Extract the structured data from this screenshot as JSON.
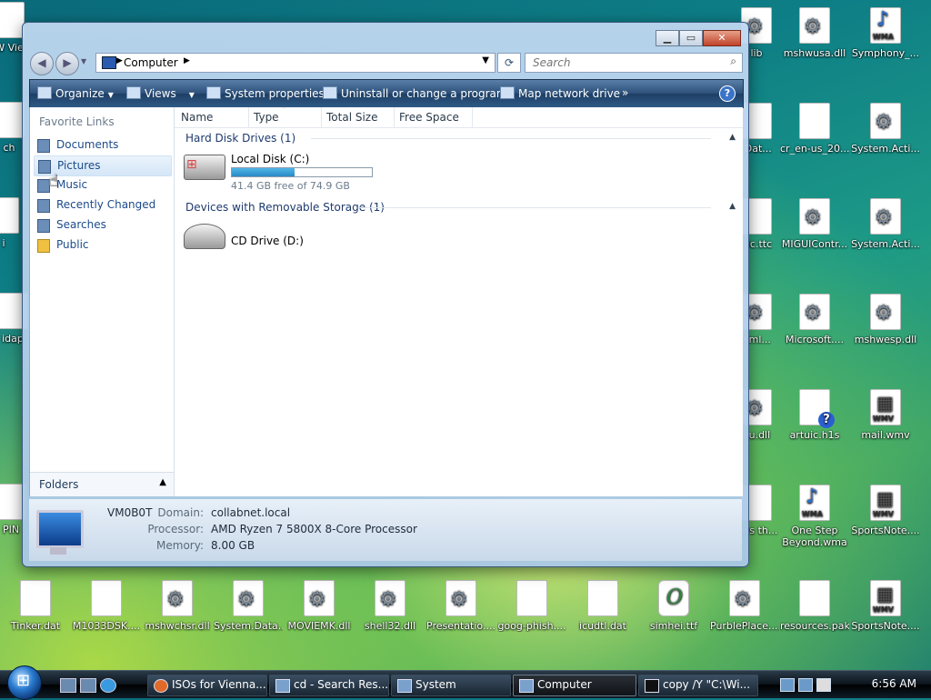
{
  "desktop": {
    "icons_right": [
      {
        "label": "mshwusa.dll",
        "type": "gear"
      },
      {
        "label": "Symphony_...",
        "type": "wma"
      },
      {
        "label": "cr_en-us_20...",
        "type": "doc"
      },
      {
        "label": "System.Acti...",
        "type": "gear"
      },
      {
        "label": "MIGUIContr...",
        "type": "gear"
      },
      {
        "label": "System.Acti...",
        "type": "gear"
      },
      {
        "label": "Microsoft....",
        "type": "gear"
      },
      {
        "label": "mshwesp.dll",
        "type": "gear"
      },
      {
        "label": "artuic.h1s",
        "type": "help"
      },
      {
        "label": "mail.wmv",
        "type": "wmv"
      },
      {
        "label": "One Step Beyond.wma",
        "type": "wma"
      },
      {
        "label": "SportsNote....",
        "type": "wmv"
      },
      {
        "label": "resources.pak",
        "type": "doc"
      },
      {
        "label": "SportsNote....",
        "type": "wmv"
      }
    ],
    "icons_partial": [
      {
        "label": "lib"
      },
      {
        "label": ".Dat..."
      },
      {
        "label": "nic.ttc"
      },
      {
        "label": "Xml..."
      },
      {
        "label": "eu.dll"
      },
      {
        "label": "ows th..."
      }
    ],
    "icons_bottom": [
      {
        "label": "Tinker.dat",
        "type": "doc"
      },
      {
        "label": "M1033DSK....",
        "type": "doc"
      },
      {
        "label": "mshwchsr.dll",
        "type": "gear"
      },
      {
        "label": "System.Data....",
        "type": "gear"
      },
      {
        "label": "MOVIEMK.dll",
        "type": "gear"
      },
      {
        "label": "shell32.dll",
        "type": "gear"
      },
      {
        "label": "Presentatio....",
        "type": "gear"
      },
      {
        "label": "goog-phish....",
        "type": "doc"
      },
      {
        "label": "icudtl.dat",
        "type": "doc"
      },
      {
        "label": "simhei.ttf",
        "type": "font"
      },
      {
        "label": "PurblePlace....",
        "type": "gear"
      }
    ],
    "icons_left_partial": [
      {
        "label": "W Vie"
      },
      {
        "label": "ch"
      },
      {
        "label": "i"
      },
      {
        "label": "idap"
      },
      {
        "label": "PIN"
      }
    ]
  },
  "window": {
    "address": {
      "crumb": "Computer"
    },
    "search": {
      "placeholder": "Search"
    },
    "toolbar": {
      "organize": "Organize",
      "views": "Views",
      "system_properties": "System properties",
      "uninstall": "Uninstall or change a program",
      "map_drive": "Map network drive",
      "more": "»",
      "help": "?"
    },
    "nav": {
      "title": "Favorite Links",
      "items": [
        "Documents",
        "Pictures",
        "Music",
        "Recently Changed",
        "Searches",
        "Public"
      ],
      "folders": "Folders"
    },
    "columns": [
      "Name",
      "Type",
      "Total Size",
      "Free Space"
    ],
    "groups": [
      {
        "title": "Hard Disk Drives (1)"
      },
      {
        "title": "Devices with Removable Storage (1)"
      }
    ],
    "drives": [
      {
        "name": "Local Disk (C:)",
        "free_text": "41.4 GB free of 74.9 GB",
        "used_fraction": 0.447
      },
      {
        "name": "CD Drive (D:)"
      }
    ],
    "details": {
      "computer_name": "VM0B0T",
      "domain_label": "Domain:",
      "domain": "collabnet.local",
      "processor_label": "Processor:",
      "processor": "AMD Ryzen 7 5800X 8-Core Processor",
      "memory_label": "Memory:",
      "memory": "8.00 GB"
    }
  },
  "taskbar": {
    "buttons": [
      {
        "label": "ISOs for Vienna..."
      },
      {
        "label": "cd - Search Res..."
      },
      {
        "label": "System"
      },
      {
        "label": "Computer",
        "active": true
      },
      {
        "label": "copy /Y \"C:\\Wi..."
      }
    ],
    "clock": "6:56 AM"
  }
}
